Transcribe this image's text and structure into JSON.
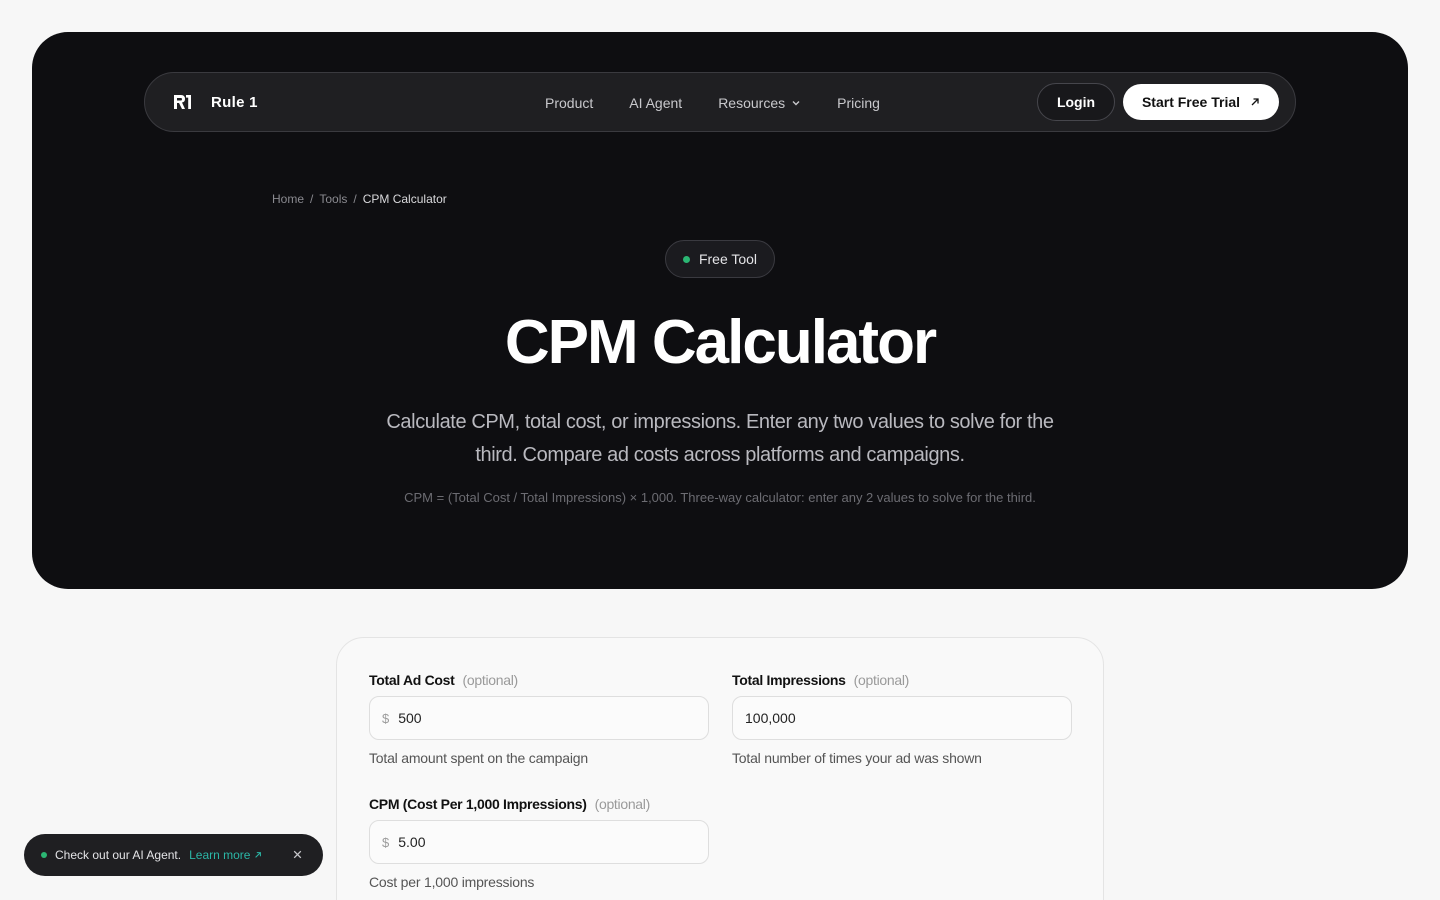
{
  "nav": {
    "logo_text": "Rule 1",
    "links": [
      "Product",
      "AI Agent",
      "Resources",
      "Pricing"
    ],
    "login_label": "Login",
    "trial_label": "Start Free Trial"
  },
  "breadcrumb": [
    "Home",
    "Tools",
    "CPM Calculator"
  ],
  "badge": "Free Tool",
  "title": "CPM Calculator",
  "subtitle": "Calculate CPM, total cost, or impressions. Enter any two values to solve for the third. Compare ad costs across platforms and campaigns.",
  "formula": "CPM = (Total Cost / Total Impressions) × 1,000. Three-way calculator: enter any 2 values to solve for the third.",
  "fields": [
    {
      "label": "Total Ad Cost",
      "optional": "(optional)",
      "prefix": "$",
      "value": "500",
      "hint": "Total amount spent on the campaign"
    },
    {
      "label": "Total Impressions",
      "optional": "(optional)",
      "prefix": "",
      "value": "100,000",
      "hint": "Total number of times your ad was shown"
    },
    {
      "label": "CPM (Cost Per 1,000 Impressions)",
      "optional": "(optional)",
      "prefix": "$",
      "value": "5.00",
      "hint": "Cost per 1,000 impressions"
    }
  ],
  "toast": {
    "text": "Check out our AI Agent.",
    "link": "Learn more"
  },
  "colors": {
    "hero_bg": "#0e0e11",
    "accent_green": "#2bb673",
    "link_teal": "#2bb6a6"
  }
}
